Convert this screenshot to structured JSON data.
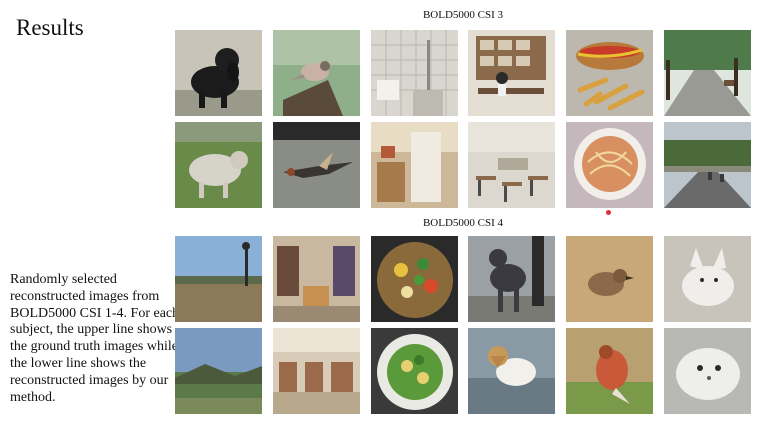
{
  "slide": {
    "title": "Results",
    "description": "Randomly selected reconstructed images from BOLD5000 CSI 1-4. For each subject, the upper line shows the ground truth images while the lower line shows the reconstructed images by our method."
  },
  "sections": [
    {
      "label": "BOLD5000 CSI 3",
      "ground_truth": [
        "black-dog-on-grass",
        "bird-on-branch",
        "tiled-bathroom",
        "office-desk-shelves",
        "hot-dog-with-fries",
        "tree-lined-path"
      ],
      "reconstructed": [
        "sheep-on-grass",
        "flying-bird",
        "kitchen-interior",
        "restaurant-interior",
        "noodle-dish",
        "road-with-trees"
      ]
    },
    {
      "label": "BOLD5000 CSI 4",
      "ground_truth": [
        "field-with-tower",
        "library-interior",
        "vegetable-stir-fry",
        "dark-dog-standing",
        "small-bird-on-ground",
        "white-fox"
      ],
      "reconstructed": [
        "field-landscape",
        "store-interior",
        "salad-plate",
        "dog-in-water",
        "bird-painting",
        "white-furry-animal"
      ]
    }
  ],
  "colors": {
    "background": "#ffffff",
    "text": "#111111",
    "marker_dot": "#e0303a"
  }
}
